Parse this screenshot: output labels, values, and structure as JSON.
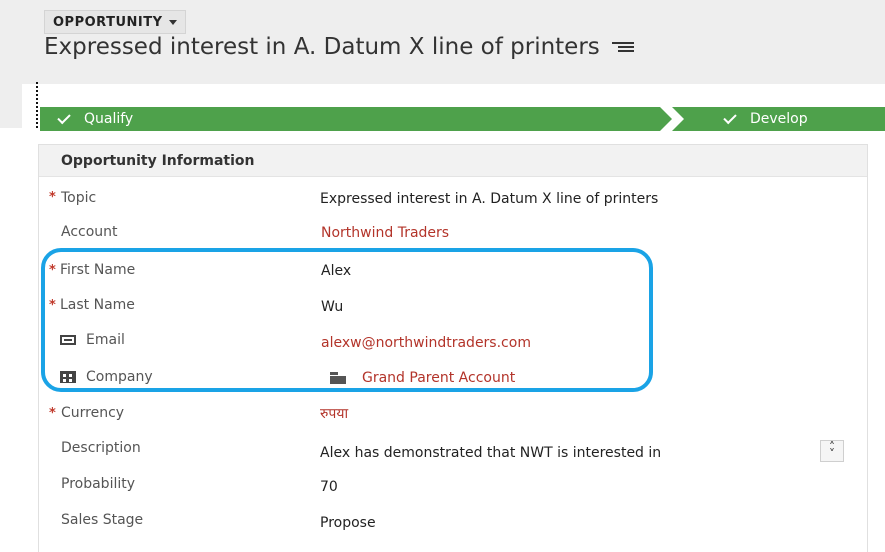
{
  "header": {
    "entity": "OPPORTUNITY",
    "title": "Expressed interest in A. Datum X line of printers"
  },
  "process": {
    "stages": [
      {
        "label": "Qualify",
        "completed": true
      },
      {
        "label": "Develop",
        "completed": true
      }
    ]
  },
  "section": {
    "title": "Opportunity Information",
    "fields": {
      "topic": {
        "label": "Topic",
        "value": "Expressed interest in A. Datum X line of printers"
      },
      "account": {
        "label": "Account",
        "value": "Northwind Traders"
      },
      "first_name": {
        "label": "First Name",
        "value": "Alex"
      },
      "last_name": {
        "label": "Last Name",
        "value": "Wu"
      },
      "email": {
        "label": "Email",
        "value": "alexw@northwindtraders.com"
      },
      "company": {
        "label": "Company",
        "value": "Grand Parent Account"
      },
      "currency": {
        "label": "Currency",
        "value": "रुपया"
      },
      "description": {
        "label": "Description",
        "value": "Alex has demonstrated that NWT is interested in"
      },
      "probability": {
        "label": "Probability",
        "value": "70"
      },
      "sales_stage": {
        "label": "Sales Stage",
        "value": "Propose"
      }
    }
  },
  "icons": {
    "email": "email-icon",
    "company": "building-icon",
    "account": "account-icon",
    "menu": "menu-icon",
    "check": "checkmark-icon"
  },
  "colors": {
    "stage_green": "#4ea14b",
    "link_red": "#b3342a",
    "highlight_blue": "#1aa3e6",
    "required_red": "#c0392b"
  }
}
